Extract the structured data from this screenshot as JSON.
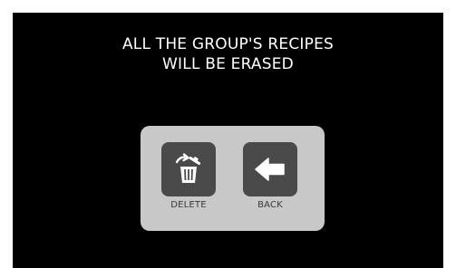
{
  "message": {
    "line1": "ALL THE GROUP'S RECIPES",
    "line2": "WILL BE ERASED"
  },
  "actions": {
    "delete": {
      "label": "DELETE",
      "icon": "trash-delete-icon"
    },
    "back": {
      "label": "BACK",
      "icon": "back-arrow-icon"
    }
  },
  "colors": {
    "screen_background": "#000000",
    "message_text": "#ffffff",
    "panel_background": "#c8c8c8",
    "button_tile": "#4a4a4a",
    "icon": "#ffffff",
    "button_label": "#3a3a3a"
  }
}
